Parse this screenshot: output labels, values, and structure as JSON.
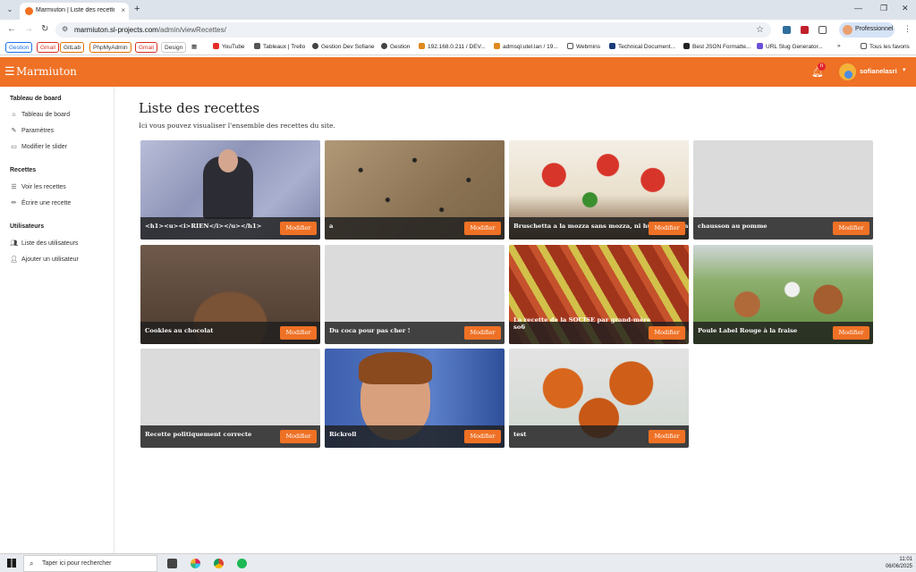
{
  "browser": {
    "tab_title": "Marmiuton | Liste des recettes",
    "url_host": "marmiuton.sl-projects.com",
    "url_path": "/admin/viewRecettes/",
    "profile_label": "Professionnel",
    "bookmarks_chips": [
      {
        "label": "Gestion",
        "color": "#1a73e8"
      },
      {
        "label": "Gmail",
        "color": "#d93025"
      },
      {
        "label": "GitLab",
        "color": "#e37400"
      },
      {
        "label": "PhpMyAdmin",
        "color": "#e37400"
      },
      {
        "label": "Gmail",
        "color": "#d93025"
      },
      {
        "label": "Design",
        "color": "#5f6368"
      }
    ],
    "bookmarks": [
      "YouTube",
      "Tableaux | Trello",
      "Gestion Dev Sofiane",
      "Gestion",
      "192.168.0.211 / DEV...",
      "admsql.utel.lan / 19...",
      "Webmins",
      "Technical Document...",
      "Best JSON Formatte...",
      "URL Slug Generator...",
      "Tous les favoris"
    ]
  },
  "navbar": {
    "brand": "Marmiuton",
    "notifications": "n",
    "user": "sofianelasri"
  },
  "sidebar": {
    "sections": [
      {
        "title": "Tableau de board",
        "items": [
          {
            "label": "Tableau de board",
            "icon": "home-icon"
          },
          {
            "label": "Paramètres",
            "icon": "wrench-icon"
          },
          {
            "label": "Modifier le slider",
            "icon": "monitor-icon"
          }
        ]
      },
      {
        "title": "Recettes",
        "items": [
          {
            "label": "Voir les recettes",
            "icon": "list-icon"
          },
          {
            "label": "Écrire une recette",
            "icon": "pencil-icon"
          }
        ]
      },
      {
        "title": "Utilisateurs",
        "items": [
          {
            "label": "Liste des utilisateurs",
            "icon": "users-icon"
          },
          {
            "label": "Ajouter un utilisateur",
            "icon": "user-plus-icon"
          }
        ]
      }
    ]
  },
  "main": {
    "title": "Liste des recettes",
    "subtitle": "Ici vous pouvez visualiser l'ensemble des recettes du site.",
    "edit_label": "Modifier",
    "recipes": [
      {
        "name": "<h1><u><i>RIEN</i></u></h1>",
        "image": "rick"
      },
      {
        "name": "a",
        "image": "pegs"
      },
      {
        "name": "Bruschetta a la mozza sans mozza, ni huile, ni pain",
        "image": "brusch"
      },
      {
        "name": "chausson au pomme",
        "image": "none"
      },
      {
        "name": "Cookies au chocolat",
        "image": "cookie"
      },
      {
        "name": "Du coca pour pas cher !",
        "image": "none"
      },
      {
        "name": "La recette de la SOCISE par grand-mère so6",
        "image": "sauce"
      },
      {
        "name": "Poule Label Rouge à la fraise",
        "image": "hens"
      },
      {
        "name": "Recette politiquement correcte",
        "image": "none"
      },
      {
        "name": "Rickroll",
        "image": "rick2"
      },
      {
        "name": "test",
        "image": "chicken"
      }
    ]
  },
  "taskbar": {
    "search_placeholder": "Taper ici pour rechercher",
    "time": "11:01",
    "date": "06/06/2025"
  },
  "colors": {
    "accent": "#ef7125",
    "overlay": "#1e1e1e"
  }
}
